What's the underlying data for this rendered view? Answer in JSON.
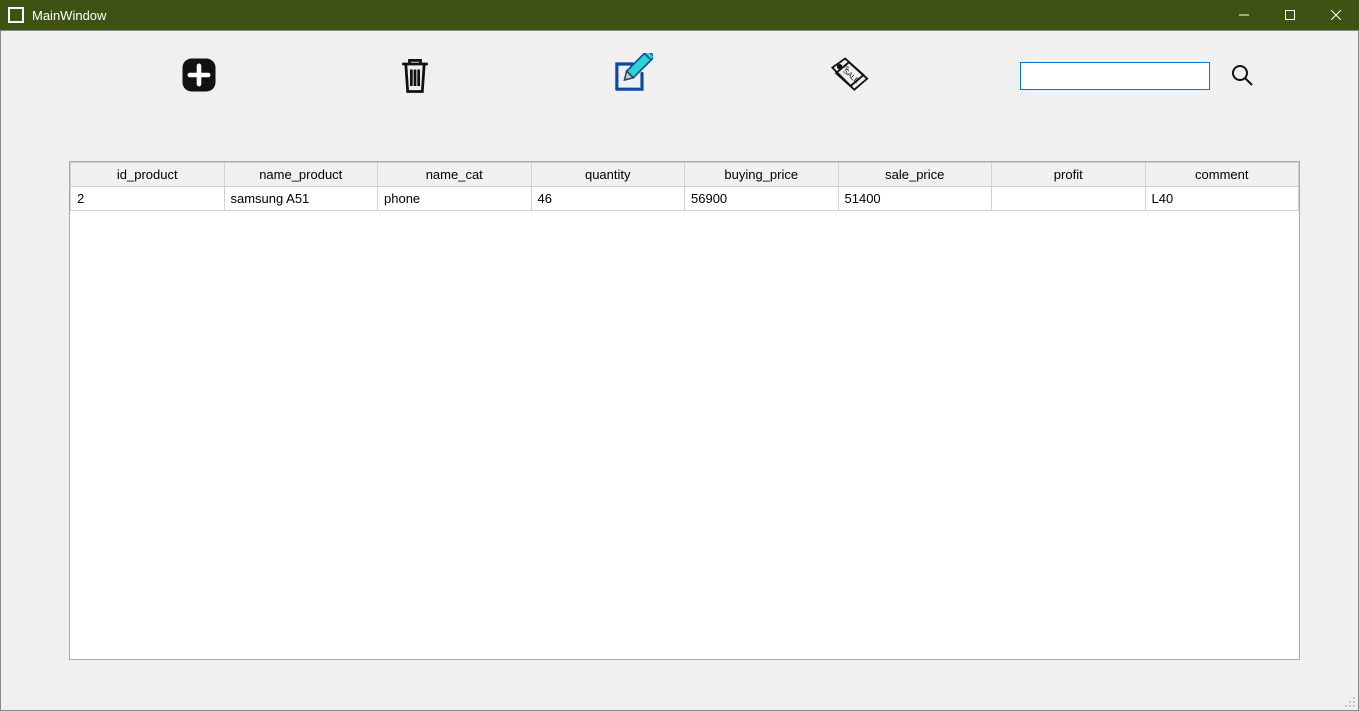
{
  "window": {
    "title": "MainWindow"
  },
  "toolbar": {
    "add_label": "Add",
    "delete_label": "Delete",
    "edit_label": "Edit",
    "sale_label": "Sale",
    "search_value": "",
    "search_placeholder": ""
  },
  "table": {
    "columns": [
      "id_product",
      "name_product",
      "name_cat",
      "quantity",
      "buying_price",
      "sale_price",
      "profit",
      "comment"
    ],
    "rows": [
      {
        "id_product": "2",
        "name_product": "samsung A51",
        "name_cat": "phone",
        "quantity": "46",
        "buying_price": "56900",
        "sale_price": "51400",
        "profit": "",
        "comment": "L40"
      }
    ]
  }
}
